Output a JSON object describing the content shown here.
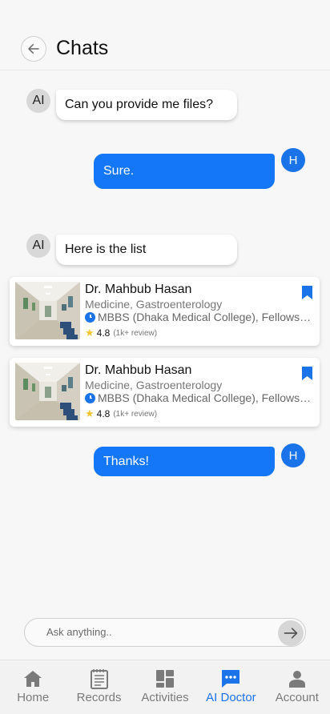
{
  "header": {
    "title": "Chats"
  },
  "messages": [
    {
      "sender": "AI",
      "text": "Can you provide me files?"
    },
    {
      "sender": "H",
      "text": "Sure."
    },
    {
      "sender": "AI",
      "text": "Here is the list"
    },
    {
      "sender": "H",
      "text": "Thanks!"
    }
  ],
  "doctors": [
    {
      "name": "Dr. Mahbub Hasan",
      "specialty": "Medicine, Gastroenterology",
      "degree": "MBBS (Dhaka Medical College), Fellowship in Gastroenterology",
      "rating": "4.8",
      "reviews": "(1k+ review)",
      "bookmarked": true
    },
    {
      "name": "Dr. Mahbub Hasan",
      "specialty": "Medicine, Gastroenterology",
      "degree": "MBBS (Dhaka Medical College), Fellowship in Gastroenterology",
      "rating": "4.8",
      "reviews": "(1k+ review)",
      "bookmarked": true
    }
  ],
  "composer": {
    "placeholder": "Ask anything.."
  },
  "nav": {
    "items": [
      {
        "label": "Home",
        "icon": "home-icon",
        "active": false
      },
      {
        "label": "Records",
        "icon": "records-icon",
        "active": false
      },
      {
        "label": "Activities",
        "icon": "activities-icon",
        "active": false
      },
      {
        "label": "AI Doctor",
        "icon": "chat-icon",
        "active": true
      },
      {
        "label": "Account",
        "icon": "account-icon",
        "active": false
      }
    ]
  },
  "colors": {
    "accent": "#1a73e8",
    "outgoing_bubble": "#1477f8",
    "star": "#f4c430"
  }
}
